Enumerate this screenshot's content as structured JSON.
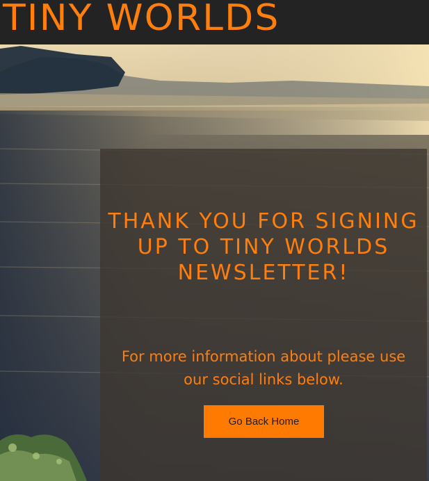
{
  "header": {
    "site_title": "TINY WORLDS"
  },
  "main": {
    "headline": "THANK YOU FOR SIGNING UP TO TINY WORLDS NEWSLETTER!",
    "body": "For more information about please use our social links below.",
    "button_label": "Go Back Home"
  },
  "colors": {
    "accent": "#ff7f0e",
    "header_bg": "#232323",
    "button_bg": "#ff7a00"
  }
}
